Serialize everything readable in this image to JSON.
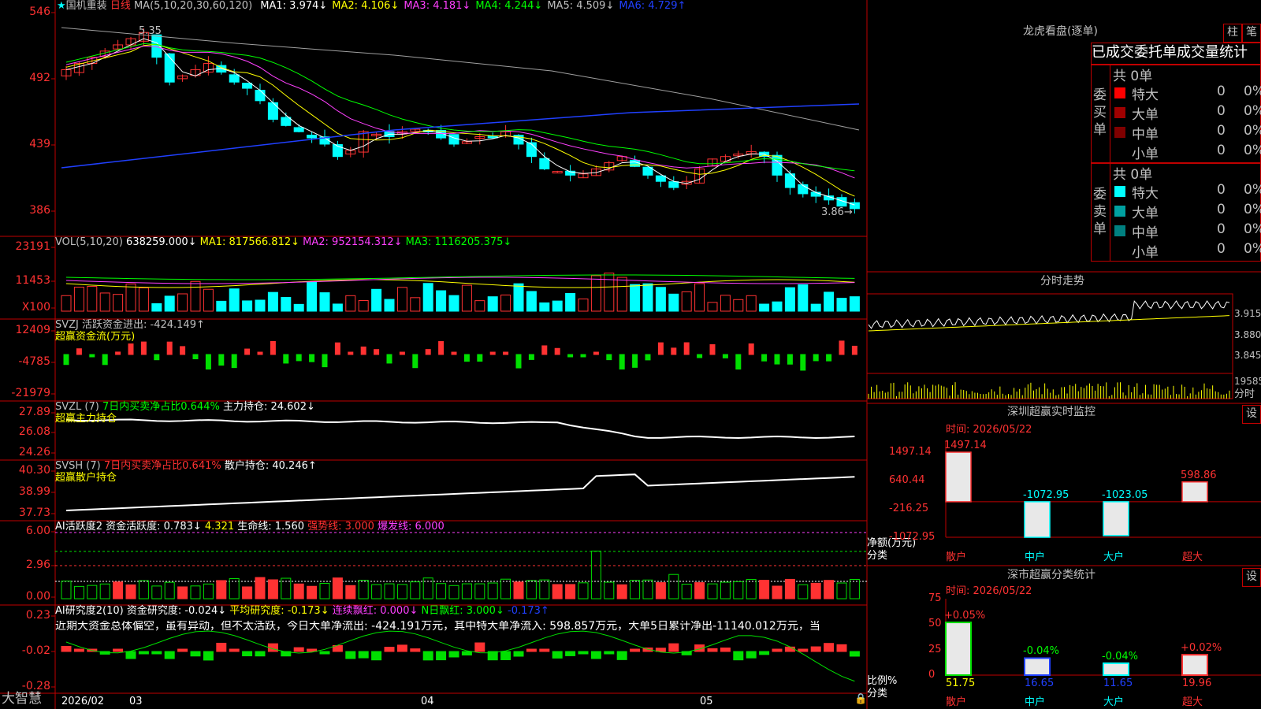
{
  "colors": {
    "red": "#ff3232",
    "cyan": "#00ffff",
    "green": "#00e000",
    "frame": "#c00000",
    "white": "#ffffff",
    "yellow": "#ffff00",
    "magenta": "#ff40ff",
    "lime": "#00ff00",
    "blue": "#2040ff",
    "gray": "#a0a0a0"
  },
  "main": {
    "star": "★",
    "name": "国机重装",
    "period": "日线",
    "ma_label": "MA(5,10,20,30,60,120)",
    "ma": [
      {
        "label": "MA1: 3.974↓",
        "color": "#ffffff"
      },
      {
        "label": "MA2: 4.106↓",
        "color": "#ffff00"
      },
      {
        "label": "MA3: 4.181↓",
        "color": "#ff40ff"
      },
      {
        "label": "MA4: 4.244↓",
        "color": "#00ff00"
      },
      {
        "label": "MA5: 4.509↓",
        "color": "#c0c0c0"
      },
      {
        "label": "MA6: 4.729↑",
        "color": "#2040ff"
      }
    ],
    "axis": [
      "546",
      "492",
      "439",
      "386"
    ],
    "high_label": "5.35",
    "low_label": "3.86→"
  },
  "vol": {
    "label": "VOL(5,10,20)",
    "v": "638259.000↓",
    "ma1": "MA1: 817566.812↓",
    "ma2": "MA2: 952154.312↓",
    "ma3": "MA3: 1116205.375↓",
    "axis": [
      "23191",
      "11453",
      "X100"
    ]
  },
  "svzj": {
    "label": "SVZJ  活跃资金进出: -424.149↑",
    "sub": "超赢资金流(万元)",
    "axis": [
      "12409",
      "-4785",
      "-21979"
    ]
  },
  "svzl": {
    "label": "SVZL (7)",
    "pct": "7日内买卖净占比0.644%",
    "hold": "主力持仓: 24.602↓",
    "sub": "超赢主力持仓",
    "axis": [
      "27.89",
      "26.08",
      "24.26"
    ]
  },
  "svsh": {
    "label": "SVSH (7)",
    "pct": "7日内买卖净占比0.641%",
    "hold": "散户持仓: 40.246↑",
    "sub": "超赢散户持仓",
    "axis": [
      "40.30",
      "38.99",
      "37.73"
    ]
  },
  "ai1": {
    "label": "AI活跃度2 资金活跃度: 0.783↓",
    "v2": "4.321",
    "life": "生命线: 1.560",
    "strong": "强势线: 3.000",
    "burst": "爆发线: 6.000",
    "axis": [
      "6.00",
      "2.96",
      "0.00"
    ]
  },
  "ai2": {
    "label": "AI研究度2(10) 资金研究度: -0.024↓",
    "avg": "平均研究度: -0.173↓",
    "lian": "连续飘红: 0.000↓",
    "nday": "N日飘红: 3.000↓",
    "last": "-0.173↑",
    "axis": [
      "0.23",
      "-0.02",
      "-0.28"
    ],
    "comment": "近期大资金总体偏空，虽有异动，但不太活跃，今日大单净流出: -424.191万元，其中特大单净流入: 598.857万元，大单5日累计净出-11140.012万元，当"
  },
  "dates": {
    "brand": "大智慧",
    "d1": "2026/02",
    "d2": "03",
    "d3": "04",
    "d4": "05"
  },
  "lhb": {
    "title": "龙虎看盘(逐单)",
    "btn1": "柱",
    "btn2": "笔",
    "header": "已成交委托单成交量统计",
    "buy_label": "委买单",
    "sell_label": "委卖单",
    "buy_total": "共 0单",
    "sell_total": "共 0单",
    "buy": [
      {
        "name": "特大",
        "count": "0",
        "pct": "0%",
        "color": "#ff0000"
      },
      {
        "name": "大单",
        "count": "0",
        "pct": "0%",
        "color": "#a00000"
      },
      {
        "name": "中单",
        "count": "0",
        "pct": "0%",
        "color": "#800000"
      },
      {
        "name": "小单",
        "count": "0",
        "pct": "0%",
        "color": "#000000"
      }
    ],
    "sell": [
      {
        "name": "特大",
        "count": "0",
        "pct": "0%",
        "color": "#00ffff"
      },
      {
        "name": "大单",
        "count": "0",
        "pct": "0%",
        "color": "#00a0a0"
      },
      {
        "name": "中单",
        "count": "0",
        "pct": "0%",
        "color": "#008080"
      },
      {
        "name": "小单",
        "count": "0",
        "pct": "0%",
        "color": "#000000"
      }
    ]
  },
  "fenshi": {
    "title": "分时走势",
    "p1": "3.915",
    "p2": "3.880",
    "p3": "3.845",
    "vol": "19585",
    "unit": "分时"
  },
  "monitor": {
    "title": "深圳超赢实时监控",
    "btn": "设",
    "time": "时间: 2026/05/22",
    "axis": [
      "1497.14",
      "640.44",
      "-216.25",
      "-1072.95"
    ],
    "ylabel": "净额(万元)",
    "xlabel": "分类"
  },
  "stats": {
    "title": "深市超赢分类统计",
    "btn": "设",
    "time": "时间: 2026/05/22",
    "axis": [
      "75",
      "50",
      "25",
      "0"
    ],
    "ylabel": "比例%",
    "xlabel": "分类"
  },
  "chart_data": [
    {
      "type": "bar",
      "title": "深圳超赢实时监控",
      "categories": [
        "散户",
        "中户",
        "大户",
        "超大"
      ],
      "values": [
        1497.14,
        -1072.95,
        -1023.05,
        598.86
      ],
      "labels": [
        "1497.14",
        "-1072.95",
        "-1023.05",
        "598.86"
      ],
      "ylim": [
        -1072.95,
        1497.14
      ],
      "ylabel": "净额(万元)",
      "xlabel": "分类"
    },
    {
      "type": "bar",
      "title": "深市超赢分类统计",
      "categories": [
        "散户",
        "中户",
        "大户",
        "超大"
      ],
      "values": [
        51.75,
        16.65,
        11.65,
        19.96
      ],
      "labels": [
        "51.75",
        "16.65",
        "11.65",
        "19.96"
      ],
      "changes": [
        "+0.05%",
        "-0.04%",
        "-0.04%",
        "+0.02%"
      ],
      "ylim": [
        0,
        75
      ],
      "ylabel": "比例%",
      "xlabel": "分类"
    }
  ]
}
